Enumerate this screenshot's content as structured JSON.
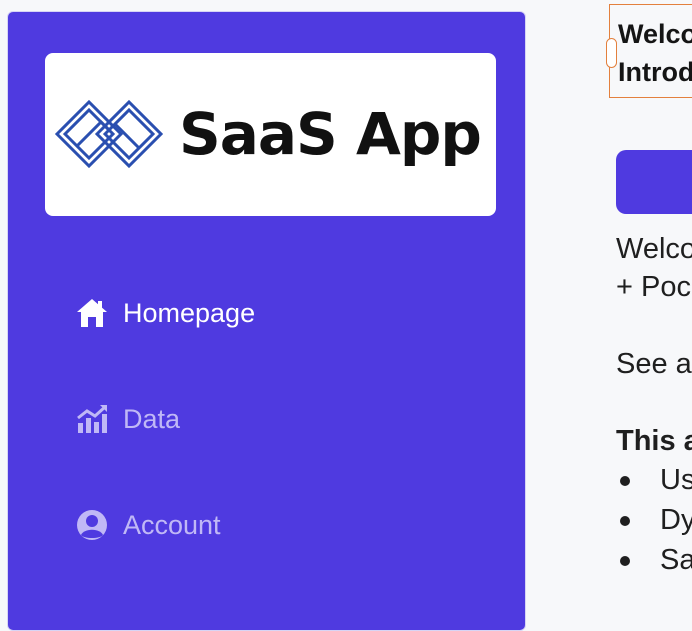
{
  "sidebar": {
    "logo": {
      "text": "SaaS App",
      "icon": "interlocking-diamonds-logo"
    },
    "items": [
      {
        "label": "Homepage",
        "icon": "home-icon",
        "active": true
      },
      {
        "label": "Data",
        "icon": "chart-icon",
        "active": false
      },
      {
        "label": "Account",
        "icon": "user-circle-icon",
        "active": false
      }
    ]
  },
  "main": {
    "header": {
      "line1": "Welco",
      "line2": "Introd"
    },
    "intro": {
      "line1": "Welco",
      "line2": "+ Poc"
    },
    "see_line": "See a",
    "section_title": "This a",
    "bullets": [
      "Us",
      "Dy",
      "Sa"
    ]
  },
  "colors": {
    "accent": "#4f3ae0",
    "header_border": "#e3803d",
    "nav_dim": "#c0b8f6"
  }
}
